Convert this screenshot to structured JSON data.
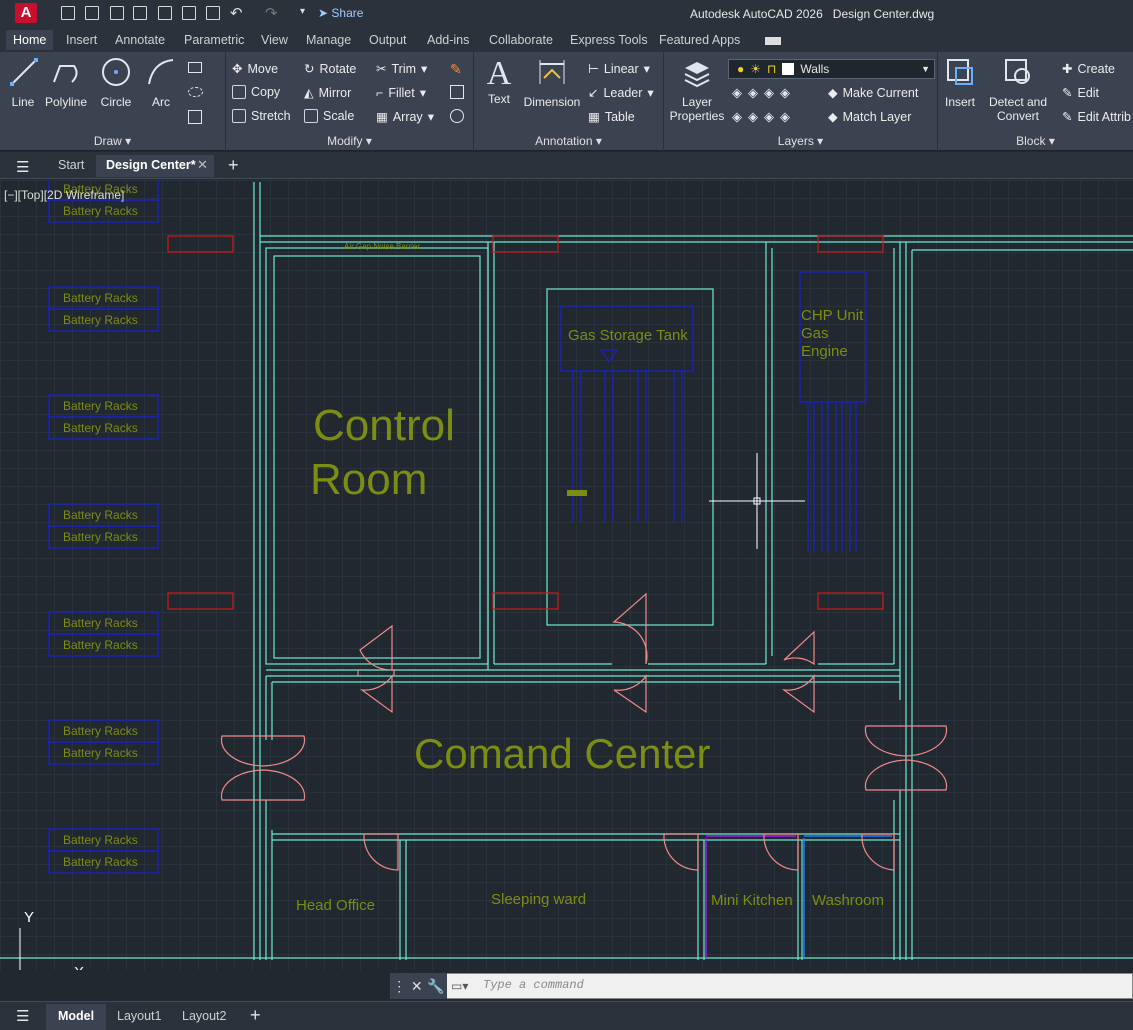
{
  "app": {
    "title": "Autodesk AutoCAD 2026",
    "file": "Design Center.dwg",
    "logo": "A",
    "share_label": "Share"
  },
  "ribbon_tabs": [
    "Home",
    "Insert",
    "Annotate",
    "Parametric",
    "View",
    "Manage",
    "Output",
    "Add-ins",
    "Collaborate",
    "Express Tools",
    "Featured Apps"
  ],
  "draw": {
    "title": "Draw",
    "line": "Line",
    "polyline": "Polyline",
    "circle": "Circle",
    "arc": "Arc"
  },
  "modify": {
    "title": "Modify",
    "move": "Move",
    "rotate": "Rotate",
    "trim": "Trim",
    "copy": "Copy",
    "mirror": "Mirror",
    "fillet": "Fillet",
    "stretch": "Stretch",
    "scale": "Scale",
    "array": "Array"
  },
  "annotation": {
    "title": "Annotation",
    "text": "Text",
    "dimension": "Dimension",
    "linear": "Linear",
    "leader": "Leader",
    "table": "Table"
  },
  "layers": {
    "title": "Layers",
    "props_line1": "Layer",
    "props_line2": "Properties",
    "current_layer": "Walls",
    "make_current": "Make Current",
    "match_layer": "Match Layer"
  },
  "block": {
    "title": "Block",
    "insert": "Insert",
    "detect_line1": "Detect and",
    "detect_line2": "Convert",
    "create": "Create",
    "edit": "Edit",
    "edit_attrib": "Edit Attrib"
  },
  "file_tabs": {
    "start": "Start",
    "active": "Design Center*"
  },
  "viewport": {
    "label": "[−][Top][2D Wireframe]"
  },
  "drawing": {
    "battery_label": "Battery Racks",
    "control_room_1": "Control",
    "control_room_2": "Room",
    "air_gap": "Air Gap Noise Barrier",
    "gas_tank": "Gas Storage Tank",
    "chp_1": "CHP Unit",
    "chp_2": "Gas",
    "chp_3": "Engine",
    "command_center": "Comand Center",
    "head_office": "Head Office",
    "sleeping": "Sleeping ward",
    "kitchen": "Mini Kitchen",
    "washroom": "Washroom",
    "axis_x": "X",
    "axis_y": "Y"
  },
  "command": {
    "placeholder": "Type a command"
  },
  "layout_tabs": {
    "model": "Model",
    "layout1": "Layout1",
    "layout2": "Layout2"
  },
  "colors": {
    "wall": "#6ee8d0",
    "text": "#7c8e12",
    "rack": "#1a22c8",
    "door": "#f08a8a",
    "red": "#d11818"
  }
}
